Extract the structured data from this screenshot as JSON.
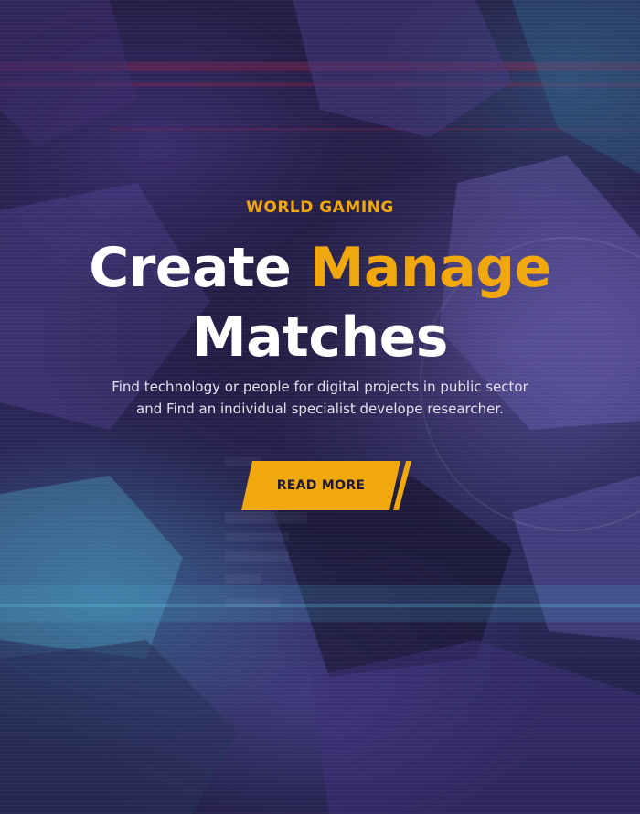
{
  "hero": {
    "eyebrow": "WORLD GAMING",
    "title_part1": "Create ",
    "title_accent": "Manage",
    "title_line2": "Matches",
    "subtitle_line1": "Find technology or people for digital projects in public sector",
    "subtitle_line2": "and Find an individual specialist develope researcher.",
    "button_label": "READ MORE"
  },
  "colors": {
    "accent": "#f0a80e",
    "heading": "#ffffff",
    "background": "#251d44",
    "button_text": "#1d1838"
  }
}
